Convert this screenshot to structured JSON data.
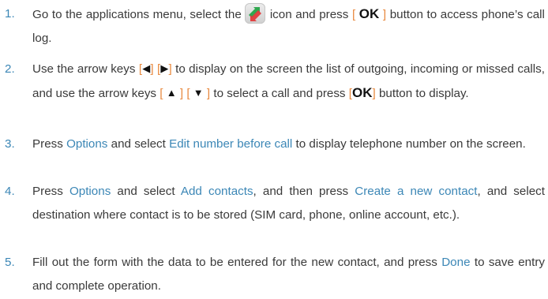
{
  "steps": [
    {
      "number": "1.",
      "parts": {
        "a": "Go to the applications menu, select the",
        "b": "icon and press",
        "bracket_open": "[",
        "ok": "OK",
        "bracket_close": "]",
        "c": "button to access phone’s call log."
      }
    },
    {
      "number": "2.",
      "parts": {
        "a": "Use the arrow keys",
        "b1_open": "[",
        "left_arrow": "◀",
        "b1_close": "]",
        "b2_open": "[",
        "right_arrow": "▶",
        "b2_close": "]",
        "c": "to display on the screen the list of outgoing, incoming or missed calls, and use the arrow keys",
        "b3_open": "[",
        "up_arrow": "▲",
        "b3_close": "]",
        "b4_open": "[",
        "down_arrow": "▼",
        "b4_close": "]",
        "d": "to select a call and press",
        "b5_open": "[",
        "ok": "OK",
        "b5_close": "]",
        "e": "button to display."
      }
    },
    {
      "number": "3.",
      "parts": {
        "a": "Press",
        "options": "Options",
        "b": "and select",
        "edit": "Edit number before call",
        "c": "to display telephone number on the screen."
      }
    },
    {
      "number": "4.",
      "parts": {
        "a": "Press",
        "options": "Options",
        "b": "and select",
        "add": "Add contacts",
        "c": ", and then press",
        "create": "Create a new contact",
        "d": ", and select destination where contact is to be stored (SIM card, phone, online account, etc.)."
      }
    },
    {
      "number": "5.",
      "parts": {
        "a": "Fill out the form with the data to be entered for the new contact, and press",
        "done": "Done",
        "b": "to save entry and complete operation."
      }
    }
  ],
  "icons": {
    "call_log": "call-log-icon"
  },
  "colors": {
    "text": "#3a3a3a",
    "accent_blue": "#3c87b6",
    "bracket_orange": "#e8893f"
  }
}
